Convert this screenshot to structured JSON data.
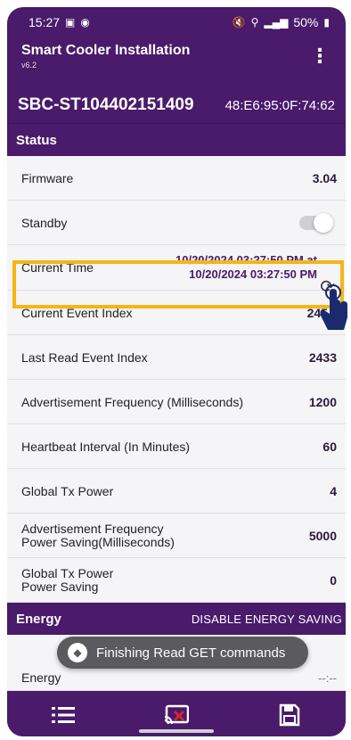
{
  "statusbar": {
    "time": "15:27",
    "right_text": "50%"
  },
  "appbar": {
    "title": "Smart Cooler Installation",
    "version": "v6.2"
  },
  "device": {
    "id": "SBC-ST104402151409",
    "mac": "48:E6:95:0F:74:62"
  },
  "status_section": {
    "title": "Status"
  },
  "rows": [
    {
      "label": "Firmware",
      "value": "3.04"
    },
    {
      "label": "Standby",
      "toggle": false
    },
    {
      "label": "Current Time",
      "value_line1": "10/20/2024 03:27:50 PM at",
      "value_line2": "10/20/2024 03:27:50 PM"
    },
    {
      "label": "Current Event Index",
      "value": "245"
    },
    {
      "label": "Last Read Event Index",
      "value": "2433"
    },
    {
      "label": "Advertisement Frequency (Milliseconds)",
      "value": "1200"
    },
    {
      "label": "Heartbeat Interval (In Minutes)",
      "value": "60"
    },
    {
      "label": "Global Tx Power",
      "value": "4"
    },
    {
      "label_line1": "Advertisement Frequency",
      "label_line2": "Power Saving(Milliseconds)",
      "value": "5000"
    },
    {
      "label_line1": "Global Tx Power",
      "label_line2": "Power Saving",
      "value": "0"
    }
  ],
  "energy_section": {
    "title": "Energy",
    "action": "DISABLE ENERGY SAVING"
  },
  "energy_row": {
    "label": "Energy",
    "value": "--:--"
  },
  "toast": {
    "text": "Finishing Read GET commands"
  },
  "colors": {
    "primary": "#4a1a6b",
    "highlight": "#f6b514",
    "list_bg": "#f5f4f6"
  },
  "bottomnav": {
    "items": [
      "list-icon",
      "cast-off-icon",
      "save-icon"
    ]
  }
}
